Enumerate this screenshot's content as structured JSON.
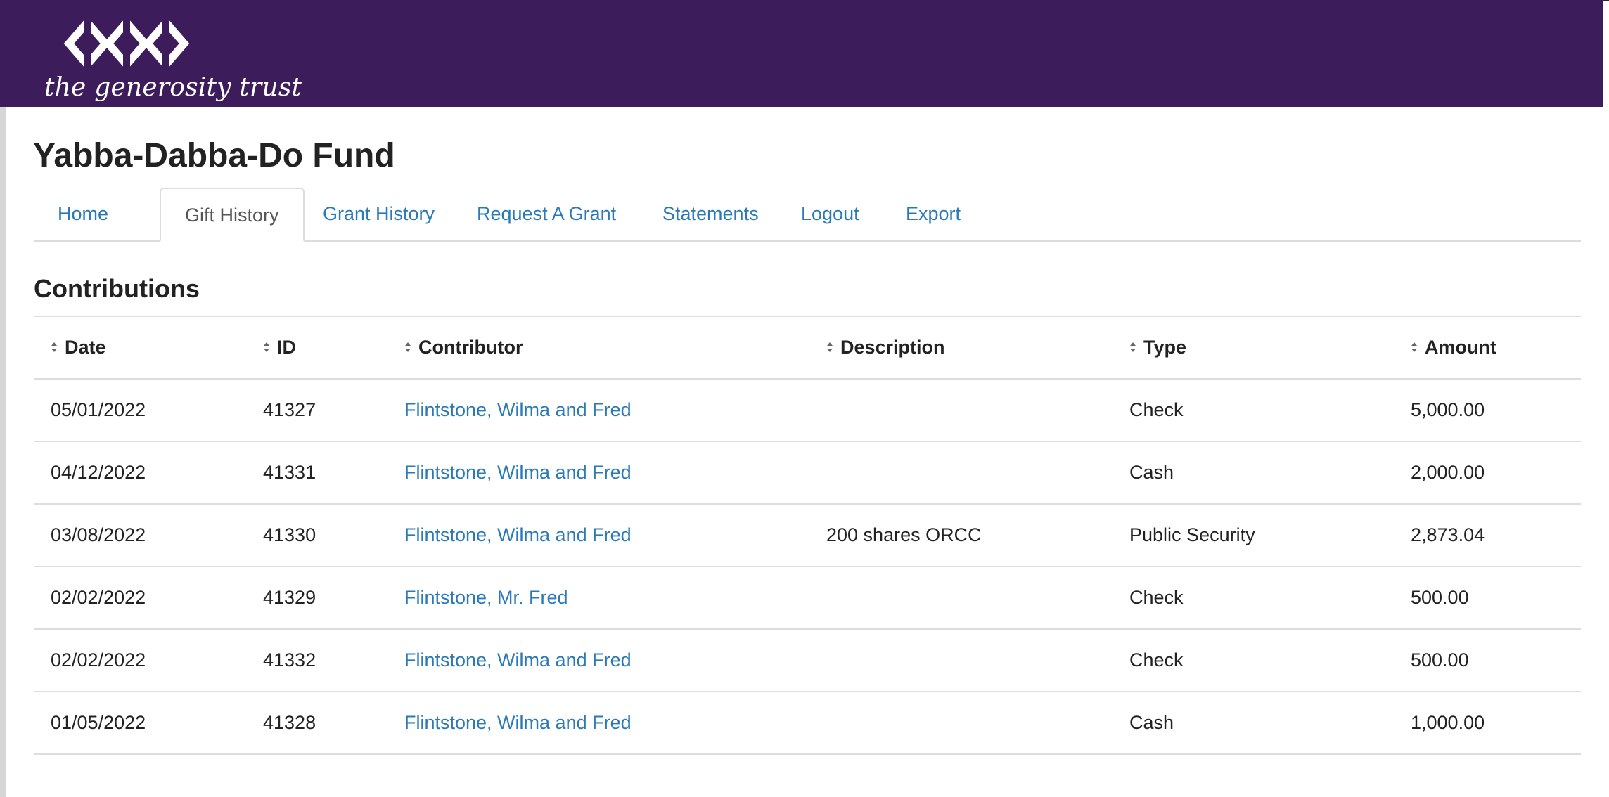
{
  "branding": {
    "logo_text": "the generosity trust",
    "header_color": "#3d1c5c",
    "link_color": "#2a7ab8"
  },
  "page": {
    "title": "Yabba-Dabba-Do Fund"
  },
  "tabs": [
    {
      "label": "Home",
      "active": false
    },
    {
      "label": "Gift History",
      "active": true
    },
    {
      "label": "Grant History",
      "active": false
    },
    {
      "label": "Request A Grant",
      "active": false
    },
    {
      "label": "Statements",
      "active": false
    },
    {
      "label": "Logout",
      "active": false
    },
    {
      "label": "Export",
      "active": false
    }
  ],
  "contributions": {
    "title": "Contributions",
    "columns": {
      "date": "Date",
      "id": "ID",
      "contributor": "Contributor",
      "description": "Description",
      "type": "Type",
      "amount": "Amount"
    },
    "rows": [
      {
        "date": "05/01/2022",
        "id": "41327",
        "contributor": "Flintstone, Wilma and Fred",
        "description": "",
        "type": "Check",
        "amount": "5,000.00"
      },
      {
        "date": "04/12/2022",
        "id": "41331",
        "contributor": "Flintstone, Wilma and Fred",
        "description": "",
        "type": "Cash",
        "amount": "2,000.00"
      },
      {
        "date": "03/08/2022",
        "id": "41330",
        "contributor": "Flintstone, Wilma and Fred",
        "description": "200 shares ORCC",
        "type": "Public Security",
        "amount": "2,873.04"
      },
      {
        "date": "02/02/2022",
        "id": "41329",
        "contributor": "Flintstone, Mr. Fred",
        "description": "",
        "type": "Check",
        "amount": "500.00"
      },
      {
        "date": "02/02/2022",
        "id": "41332",
        "contributor": "Flintstone, Wilma and Fred",
        "description": "",
        "type": "Check",
        "amount": "500.00"
      },
      {
        "date": "01/05/2022",
        "id": "41328",
        "contributor": "Flintstone, Wilma and Fred",
        "description": "",
        "type": "Cash",
        "amount": "1,000.00"
      }
    ]
  }
}
